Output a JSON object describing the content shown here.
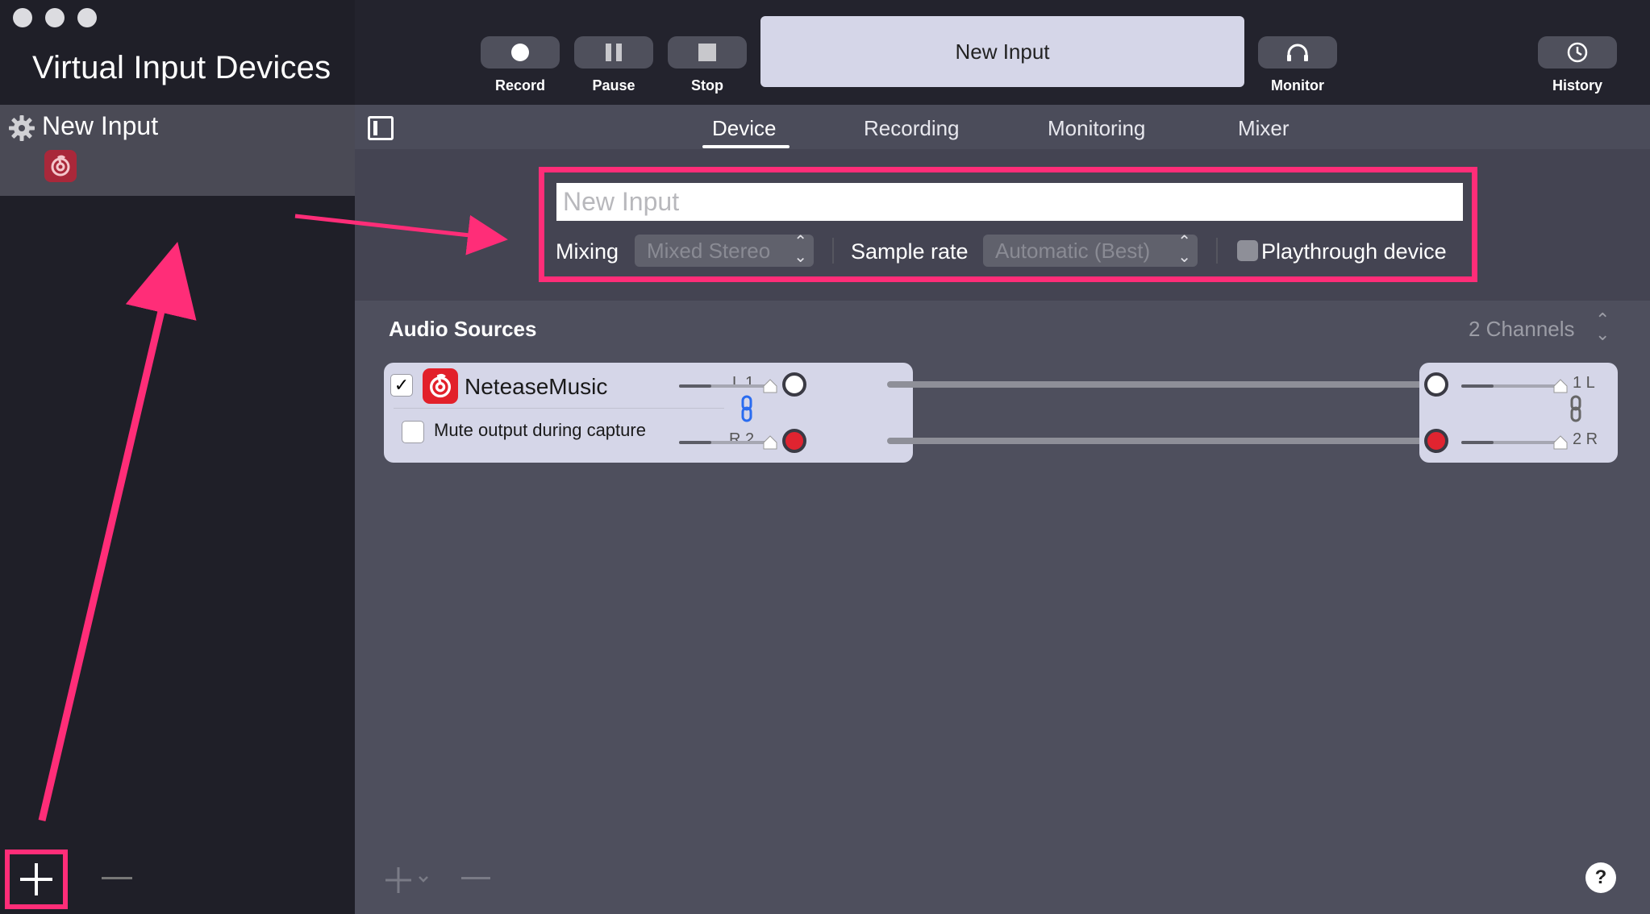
{
  "sidebar": {
    "title": "Virtual Input Devices",
    "items": [
      {
        "label": "New Input",
        "icon": "gear-icon",
        "source_icon": "netease-music-icon"
      }
    ]
  },
  "toolbar": {
    "record_label": "Record",
    "pause_label": "Pause",
    "stop_label": "Stop",
    "device_name": "New Input",
    "monitor_label": "Monitor",
    "history_label": "History"
  },
  "tabs": [
    {
      "label": "Device",
      "active": true
    },
    {
      "label": "Recording",
      "active": false
    },
    {
      "label": "Monitoring",
      "active": false
    },
    {
      "label": "Mixer",
      "active": false
    }
  ],
  "device": {
    "name_placeholder": "New Input",
    "mixing_label": "Mixing",
    "mixing_value": "Mixed Stereo",
    "sample_rate_label": "Sample rate",
    "sample_rate_value": "Automatic (Best)",
    "playthrough_label": "Playthrough device",
    "playthrough_checked": false
  },
  "sources": {
    "title": "Audio Sources",
    "channels": "2 Channels",
    "items": [
      {
        "name": "NeteaseMusic",
        "enabled": true,
        "mute_label": "Mute output during capture",
        "mute_checked": false,
        "inputs": [
          "L 1",
          "R 2"
        ],
        "outputs": [
          "1 L",
          "2 R"
        ]
      }
    ]
  },
  "colors": {
    "accent_annotation": "#ff2d78",
    "app_red": "#e2202a"
  }
}
